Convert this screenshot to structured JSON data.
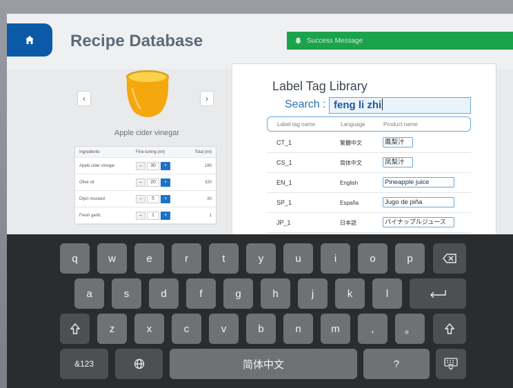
{
  "app": {
    "title": "Recipe Database",
    "banner_text": "Success Message"
  },
  "recipe": {
    "name": "Apple cider vinegar",
    "prev_label": "‹",
    "next_label": "›",
    "table_headers": [
      "Ingredients",
      "Fine-tuning (ml)",
      "Total (ml)"
    ],
    "rows": [
      {
        "name": "Apple cider vinegar",
        "tune": "30",
        "total": "180"
      },
      {
        "name": "Olive oil",
        "tune": "20",
        "total": "320"
      },
      {
        "name": "Dijon mustard",
        "tune": "5",
        "total": "20"
      },
      {
        "name": "Fresh garlic",
        "tune": "1",
        "total": "1"
      }
    ]
  },
  "library": {
    "title": "Label Tag Library",
    "search_label": "Search :",
    "search_value": "feng li zhi",
    "headers": [
      "Label tag name",
      "Language",
      "Product name"
    ],
    "rows": [
      {
        "tag": "CT_1",
        "language": "繁體中文",
        "product": "鳳梨汁"
      },
      {
        "tag": "CS_1",
        "language": "简体中文",
        "product": "凤梨汁"
      },
      {
        "tag": "EN_1",
        "language": "English",
        "product": "Pineapple juice"
      },
      {
        "tag": "SP_1",
        "language": "España",
        "product": "Jugo de piña"
      },
      {
        "tag": "JP_1",
        "language": "日本語",
        "product": "パイナップルジュース"
      }
    ]
  },
  "keyboard": {
    "row1": [
      "q",
      "w",
      "e",
      "r",
      "t",
      "y",
      "u",
      "i",
      "o",
      "p"
    ],
    "row2": [
      "a",
      "s",
      "d",
      "f",
      "g",
      "h",
      "j",
      "k",
      "l"
    ],
    "row3": [
      "z",
      "x",
      "c",
      "v",
      "b",
      "n",
      "m",
      ",",
      "。"
    ],
    "numbers_label": "&123",
    "space_label": "简体中文",
    "question_label": "?",
    "backspace_icon": "backspace-icon",
    "enter_icon": "enter-icon",
    "shift_icon": "shift-icon",
    "globe_icon": "globe-icon",
    "hide_icon": "keyboard-hide-icon"
  }
}
